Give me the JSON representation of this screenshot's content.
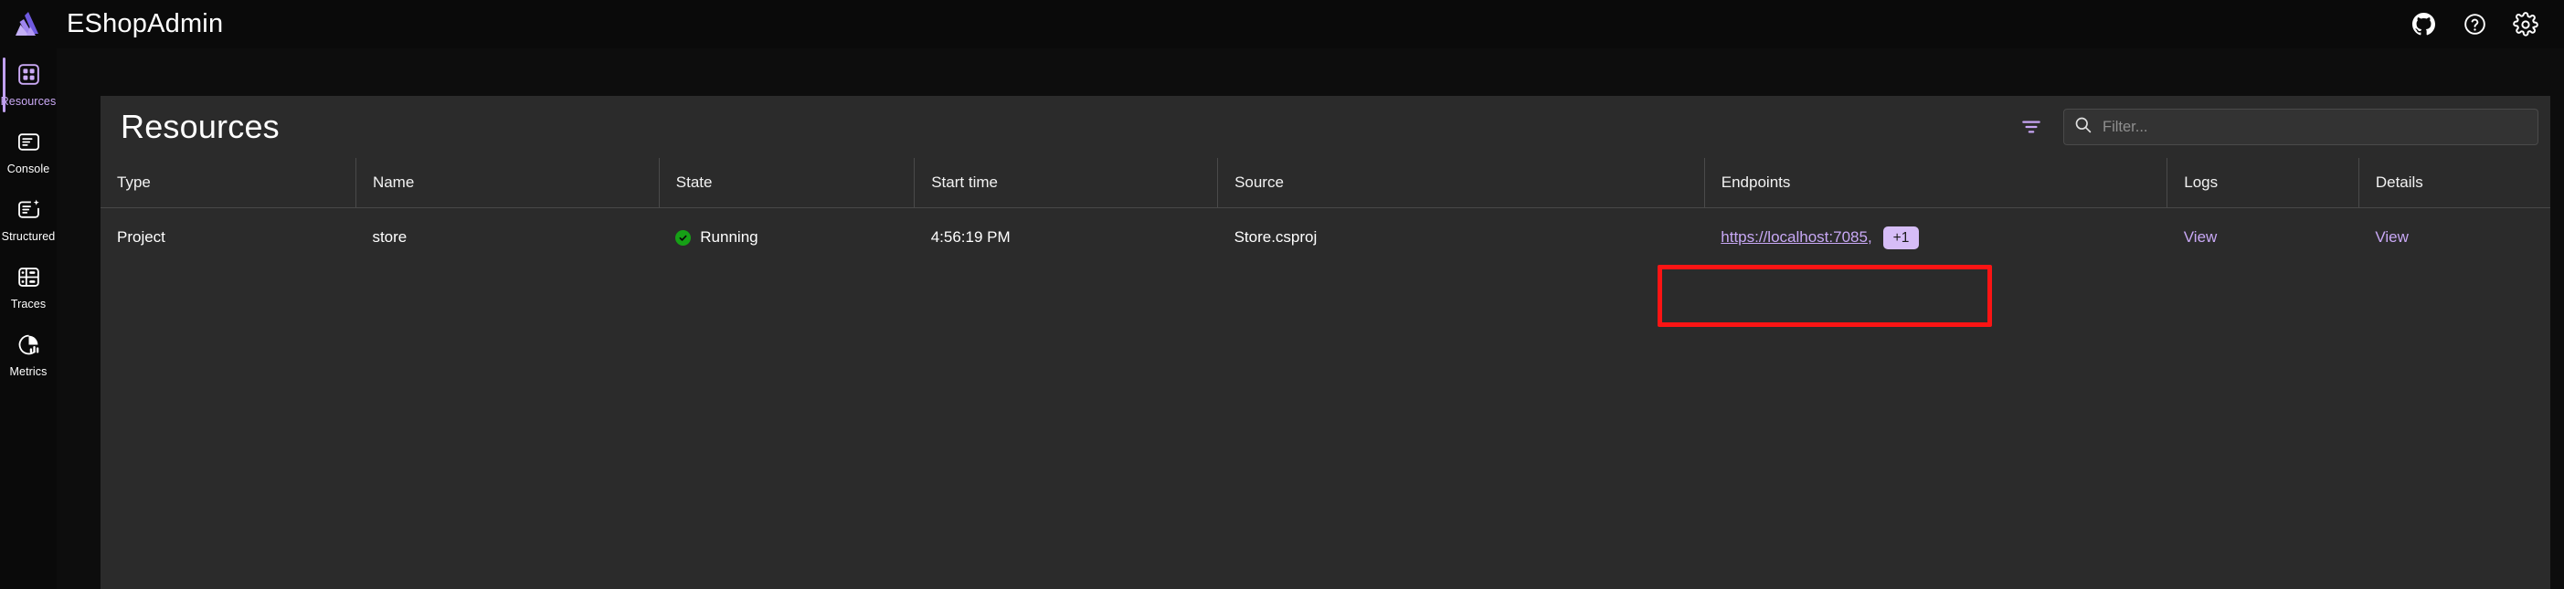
{
  "app": {
    "brand_title": "EShopAdmin",
    "logo_icon": "aspire-logo-icon"
  },
  "topbar": {
    "icons": [
      {
        "name": "github-icon",
        "label": "GitHub"
      },
      {
        "name": "help-question-icon",
        "label": "Help"
      },
      {
        "name": "settings-gear-icon",
        "label": "Settings"
      }
    ]
  },
  "sidebar": {
    "items": [
      {
        "label": "Resources",
        "icon": "grid-squares-icon",
        "active": true
      },
      {
        "label": "Console",
        "icon": "console-lines-icon",
        "active": false
      },
      {
        "label": "Structured",
        "icon": "structured-logs-icon",
        "active": false
      },
      {
        "label": "Traces",
        "icon": "traces-icon",
        "active": false
      },
      {
        "label": "Metrics",
        "icon": "metrics-pie-icon",
        "active": false
      }
    ]
  },
  "page": {
    "title": "Resources"
  },
  "toolbar": {
    "filter_icon": "filter-funnel-icon",
    "search_icon": "search-icon",
    "search_placeholder": "Filter...",
    "search_value": ""
  },
  "table": {
    "columns": [
      "Type",
      "Name",
      "State",
      "Start time",
      "Source",
      "Endpoints",
      "Logs",
      "Details"
    ],
    "rows": [
      {
        "type": "Project",
        "name": "store",
        "state": "Running",
        "state_indicator": "running-check-icon",
        "start_time": "4:56:19 PM",
        "source": "Store.csproj",
        "endpoint_url": "https://localhost:7085",
        "endpoint_separator": ",",
        "endpoint_more_badge": "+1",
        "logs_link": "View",
        "details_link": "View"
      }
    ]
  },
  "annotation": {
    "highlight_target": "endpoint-link-highlight",
    "color": "#fb1414"
  },
  "colors": {
    "accent_purple": "#c8a8f5",
    "status_running_green": "#16a016",
    "panel_background": "#2b2b2b",
    "chrome_background": "#0a0a0a",
    "badge_background": "#d6bdf7"
  }
}
